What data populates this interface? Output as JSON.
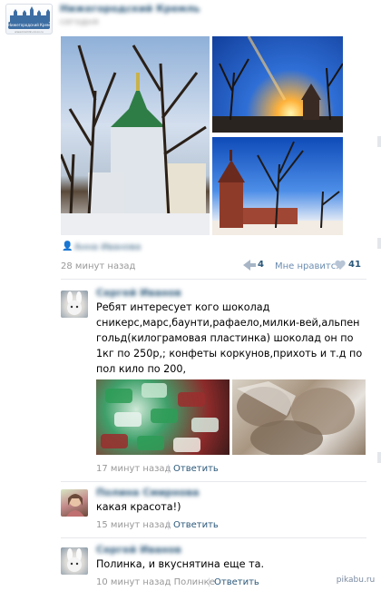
{
  "post": {
    "time": "28 минут назад",
    "share_count": "4",
    "like_label": "Мне нравится",
    "like_count": "41"
  },
  "comments": [
    {
      "text": "Ребят интересует кого шоколад сникерс,марс,баунти,рафаело,милки-вей,альпен гольд(килограмовая пластинка) шоколад он по 1кг по 250р,; конфеты коркунов,прихоть и т.д по пол кило по 200,",
      "time": "17 минут назад",
      "reply": "Ответить"
    },
    {
      "text": "какая красота!)",
      "time": "15 минут назад",
      "reply": "Ответить"
    },
    {
      "text": "Полинка, и вкуснятина еще та.",
      "time": "10 минут назад Полинке",
      "reply": "Ответить"
    }
  ],
  "watermark": "pikabu.ru",
  "logo_text": "Нижегородский Кремль"
}
